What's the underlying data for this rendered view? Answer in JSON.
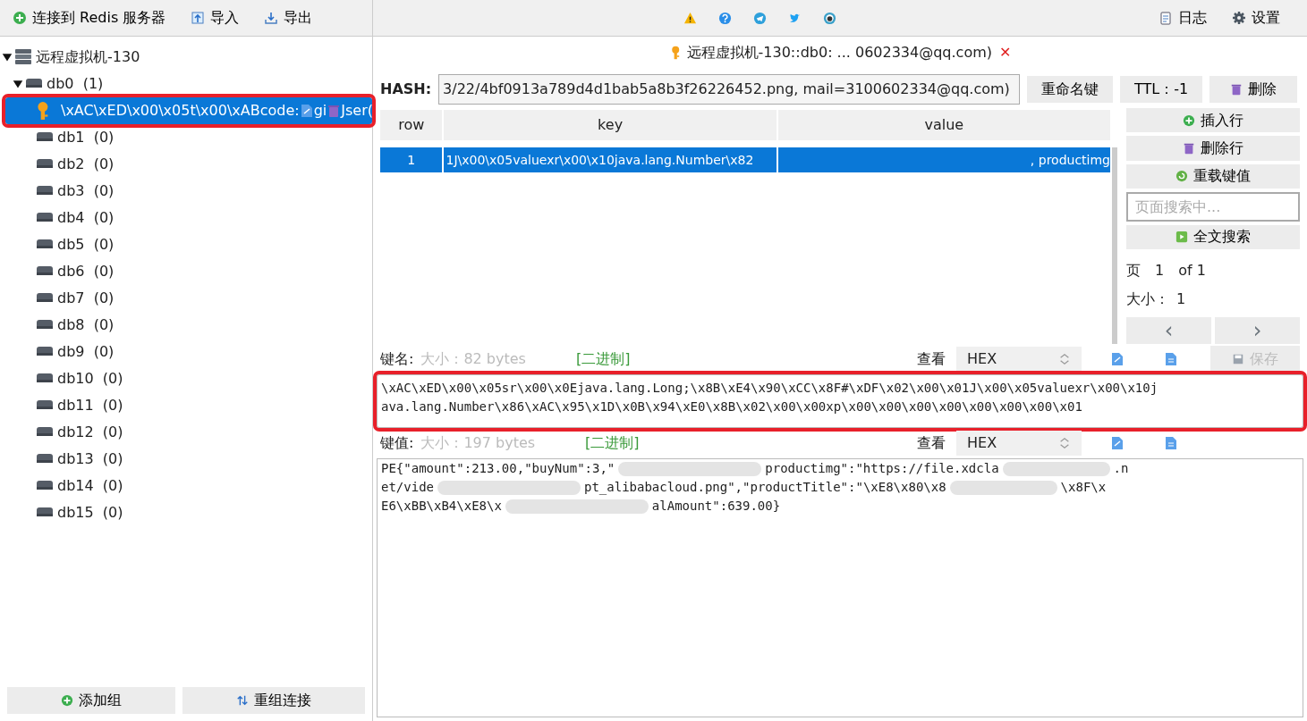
{
  "toolbar": {
    "left": [
      {
        "kind": "connect",
        "label": "连接到 Redis 服务器"
      },
      {
        "kind": "import",
        "label": "导入"
      },
      {
        "kind": "export",
        "label": "导出"
      }
    ],
    "center": [
      {
        "kind": "warning"
      },
      {
        "kind": "help"
      },
      {
        "kind": "telegram"
      },
      {
        "kind": "twitter"
      },
      {
        "kind": "github"
      }
    ],
    "right": [
      {
        "kind": "log",
        "label": "日志"
      },
      {
        "kind": "settings",
        "label": "设置"
      }
    ]
  },
  "tree": [
    {
      "label": "远程虚拟机-130",
      "expanded": true,
      "children": [
        {
          "label": "db0",
          "count": "(1)",
          "expanded": true,
          "children": [
            {
              "label": "\\xAC\\xED\\x00\\x05t\\x00\\xABcode:",
              "tail_a": "gi",
              "tail_b": "Jser(",
              "selected": true,
              "highlighted": true
            }
          ]
        },
        {
          "label": "db1",
          "count": "(0)"
        },
        {
          "label": "db2",
          "count": "(0)"
        },
        {
          "label": "db3",
          "count": "(0)"
        },
        {
          "label": "db4",
          "count": "(0)"
        },
        {
          "label": "db5",
          "count": "(0)"
        },
        {
          "label": "db6",
          "count": "(0)"
        },
        {
          "label": "db7",
          "count": "(0)"
        },
        {
          "label": "db8",
          "count": "(0)"
        },
        {
          "label": "db9",
          "count": "(0)"
        },
        {
          "label": "db10",
          "count": "(0)"
        },
        {
          "label": "db11",
          "count": "(0)"
        },
        {
          "label": "db12",
          "count": "(0)"
        },
        {
          "label": "db13",
          "count": "(0)"
        },
        {
          "label": "db14",
          "count": "(0)"
        },
        {
          "label": "db15",
          "count": "(0)"
        }
      ]
    }
  ],
  "sidebar_buttons": [
    {
      "kind": "add",
      "label": "添加组"
    },
    {
      "kind": "reorder",
      "label": "重组连接"
    }
  ],
  "tab": {
    "title": "远程虚拟机-130::db0: ... 0602334@qq.com)",
    "close": "✕"
  },
  "key_bar": {
    "type_label": "HASH:",
    "key_value": "3/22/4bf0913a789d4d1bab5a8b3f26226452.png, mail=3100602334@qq.com)",
    "rename": "重命名键",
    "ttl": "TTL：-1",
    "delete": "删除"
  },
  "table": {
    "columns": [
      "row",
      "key",
      "value"
    ],
    "rows": [
      {
        "cells": [
          "1",
          "1J\\x00\\x05valuexr\\x00\\x10java.lang.Number\\x82",
          ", productimg"
        ],
        "selected": true
      }
    ]
  },
  "side_actions": [
    {
      "kind": "insert",
      "label": "插入行"
    },
    {
      "kind": "delete",
      "label": "删除行"
    },
    {
      "kind": "reload",
      "label": "重载键值"
    },
    {
      "kind": "search_field",
      "placeholder": "页面搜索中..."
    },
    {
      "kind": "fulltext",
      "label": "全文搜索"
    }
  ],
  "paging": {
    "page_label": "页",
    "page": "1",
    "of": "of 1",
    "size_label": "大小：",
    "size": "1",
    "prev": "‹",
    "next": "›"
  },
  "key_editor": {
    "label": "键名:",
    "size": "大小：82 bytes",
    "binary": "[二进制]",
    "view_label": "查看",
    "format": "HEX",
    "save": "保存",
    "highlighted": true,
    "lines": [
      "\\xAC\\xED\\x00\\x05sr\\x00\\x0Ejava.lang.Long;\\x8B\\xE4\\x90\\xCC\\x8F#\\xDF\\x02\\x00\\x01J\\x00\\x05valuexr\\x00\\x10j",
      "ava.lang.Number\\x86\\xAC\\x95\\x1D\\x0B\\x94\\xE0\\x8B\\x02\\x00\\x00xp\\x00\\x00\\x00\\x00\\x00\\x00\\x00\\x01"
    ]
  },
  "value_editor": {
    "label": "键值:",
    "size": "大小：197 bytes",
    "binary": "[二进制]",
    "view_label": "查看",
    "format": "HEX",
    "lines": [
      [
        "PE{\"amount\":213.00,\"buyNum\":3,\"",
        "productimg\":\"https://file.xdcla",
        ".n"
      ],
      [
        "et/vide",
        "pt_alibabacloud.png\",\"productTitle\":\"\\xE8\\x80\\x8",
        "\\x8F\\x"
      ],
      [
        "E6\\xBB\\xB4\\xE8\\x",
        "alAmount\":639.00}"
      ]
    ]
  }
}
